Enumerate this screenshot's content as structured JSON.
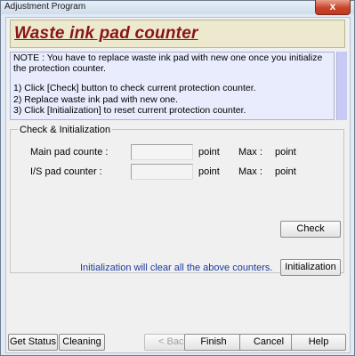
{
  "window": {
    "title": "Adjustment Program",
    "close_symbol": "x"
  },
  "heading": "Waste ink pad counter",
  "note_lines": [
    "NOTE : You have to replace waste ink pad with new one once you initialize",
    "the protection counter.",
    "1) Click [Check] button to check current protection counter.",
    "2) Replace waste ink pad with new one.",
    "3) Click [Initialization] to reset current protection counter."
  ],
  "group": {
    "title": "Check & Initialization",
    "rows": [
      {
        "label": "Main pad counte :",
        "value": "",
        "unit": "point",
        "max_label": "Max :",
        "max_unit": "point"
      },
      {
        "label": "I/S pad counter :",
        "value": "",
        "unit": "point",
        "max_label": "Max :",
        "max_unit": "point"
      }
    ],
    "check_label": "Check",
    "init_info": "Initialization will clear all the above counters.",
    "init_label": "Initialization"
  },
  "footer": {
    "get_status": "Get Status",
    "cleaning": "Cleaning",
    "back": "< Back",
    "finish": "Finish",
    "cancel": "Cancel",
    "help": "Help"
  }
}
